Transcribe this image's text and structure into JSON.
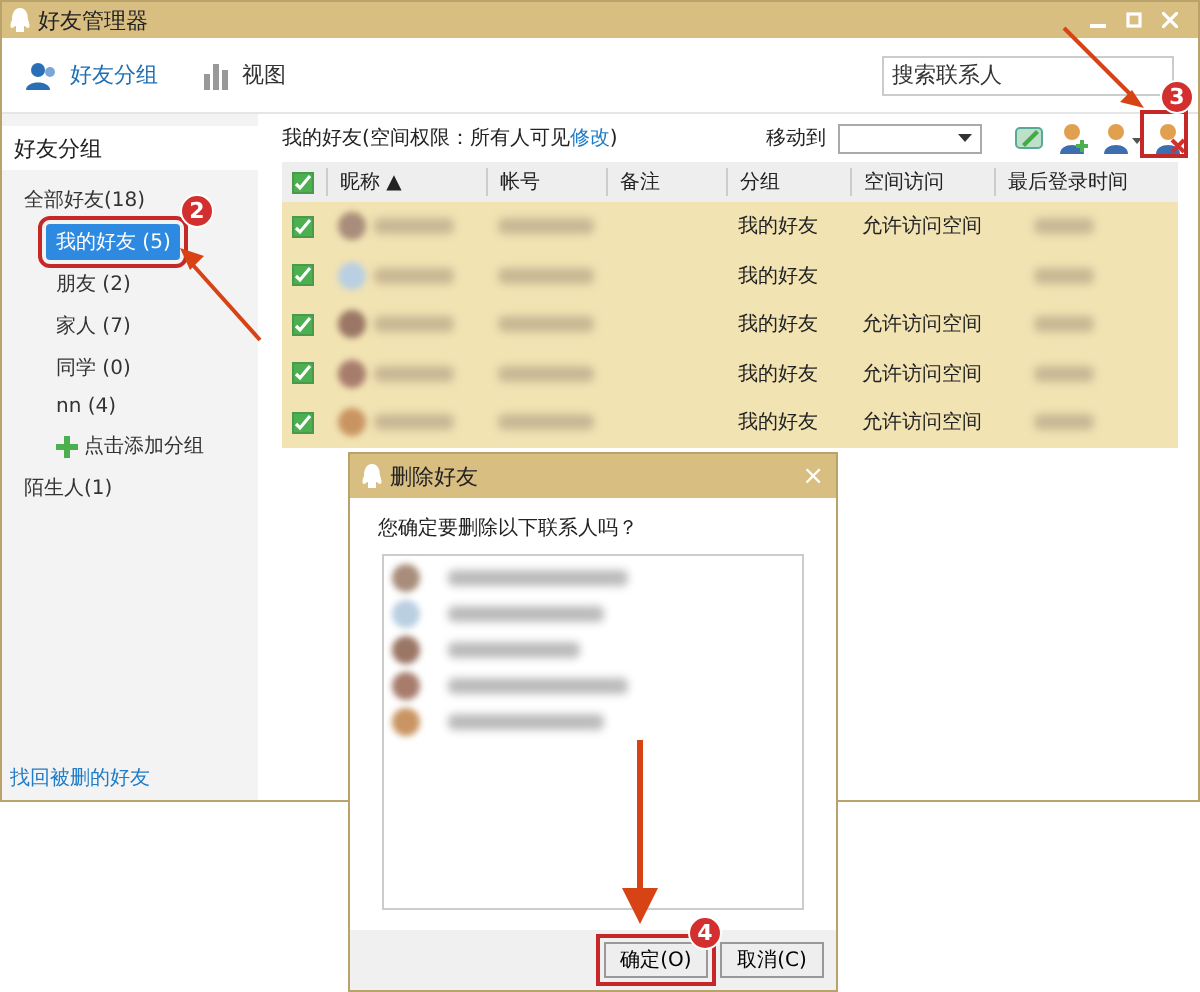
{
  "window": {
    "title": "好友管理器"
  },
  "toolbar": [
    {
      "label": "好友分组",
      "selected": true,
      "kind": "groups"
    },
    {
      "label": "视图",
      "selected": false,
      "kind": "view"
    }
  ],
  "search": {
    "placeholder": "搜索联系人"
  },
  "sidebar": {
    "title": "好友分组",
    "items": [
      {
        "label": "全部好友(18)",
        "kind": "group",
        "selected": false,
        "children": [
          {
            "label": "我的好友 (5)",
            "kind": "group",
            "selected": true
          },
          {
            "label": "朋友 (2)",
            "kind": "group",
            "selected": false
          },
          {
            "label": "家人 (7)",
            "kind": "group",
            "selected": false
          },
          {
            "label": "同学 (0)",
            "kind": "group",
            "selected": false
          },
          {
            "label": "nn (4)",
            "kind": "group",
            "selected": false
          },
          {
            "label": "点击添加分组",
            "kind": "add",
            "selected": false
          }
        ]
      },
      {
        "label": "陌生人(1)",
        "kind": "group",
        "selected": false
      }
    ],
    "footer_link": "找回被删的好友"
  },
  "content": {
    "heading": "我的好友(空间权限：所有人可见",
    "heading_link": "修改",
    "heading_end": ")",
    "move_label": "移动到"
  },
  "table": {
    "columns": [
      "昵称 ▲",
      "帐号",
      "备注",
      "分组",
      "空间访问",
      "最后登录时间"
    ],
    "all_checked": true,
    "rows": [
      {
        "checked": true,
        "group": "我的好友",
        "access": "允许访问空间"
      },
      {
        "checked": true,
        "group": "我的好友"
      },
      {
        "checked": true,
        "group": "我的好友",
        "access": "允许访问空间"
      },
      {
        "checked": true,
        "group": "我的好友",
        "access": "允许访问空间"
      },
      {
        "checked": true,
        "group": "我的好友",
        "access": "允许访问空间"
      }
    ]
  },
  "dialog": {
    "title": "删除好友",
    "close": "×",
    "question": "您确定要删除以下联系人吗？",
    "contacts": [
      {
        "kind": "blurred"
      },
      {
        "kind": "blurred"
      },
      {
        "kind": "blurred"
      },
      {
        "kind": "blurred"
      },
      {
        "kind": "blurred"
      }
    ],
    "buttons": [
      {
        "label": "确定(O)",
        "kind": "primary"
      },
      {
        "label": "取消(C)",
        "kind": "secondary"
      }
    ]
  },
  "annotations": [
    {
      "number": "2"
    },
    {
      "number": "3"
    },
    {
      "number": "4"
    }
  ]
}
